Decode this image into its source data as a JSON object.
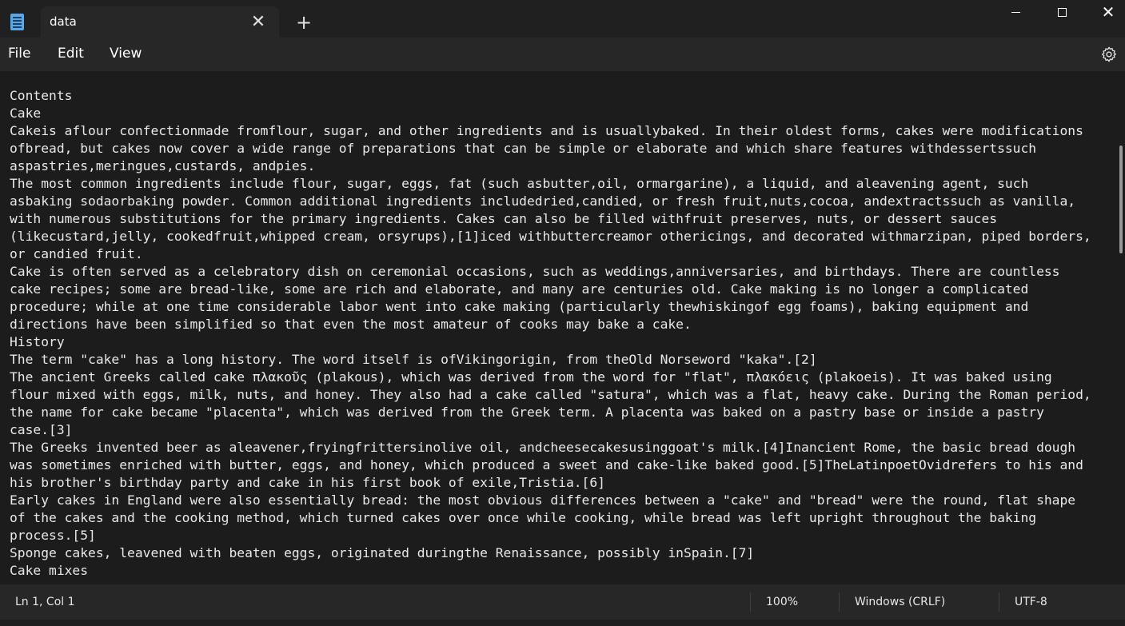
{
  "tab": {
    "title": "data",
    "close_icon": "close-icon"
  },
  "new_tab": "+",
  "window": {
    "minimize": "minimize-icon",
    "maximize": "maximize-icon",
    "close": "close-icon"
  },
  "menu": {
    "file": "File",
    "edit": "Edit",
    "view": "View"
  },
  "editor": {
    "lines": [
      "Contents",
      "Cake",
      "Cakeis aflour confectionmade fromflour, sugar, and other ingredients and is usuallybaked. In their oldest forms, cakes were modifications",
      "ofbread, but cakes now cover a wide range of preparations that can be simple or elaborate and which share features withdessertssuch",
      "aspastries,meringues,custards, andpies.",
      "The most common ingredients include flour, sugar, eggs, fat (such asbutter,oil, ormargarine), a liquid, and aleavening agent, such",
      "asbaking sodaorbaking powder. Common additional ingredients includedried,candied, or fresh fruit,nuts,cocoa, andextractssuch as vanilla,",
      "with numerous substitutions for the primary ingredients. Cakes can also be filled withfruit preserves, nuts, or dessert sauces",
      "(likecustard,jelly, cookedfruit,whipped cream, orsyrups),[1]iced withbuttercreamor othericings, and decorated withmarzipan, piped borders,",
      "or candied fruit.",
      "Cake is often served as a celebratory dish on ceremonial occasions, such as weddings,anniversaries, and birthdays. There are countless",
      "cake recipes; some are bread-like, some are rich and elaborate, and many are centuries old. Cake making is no longer a complicated",
      "procedure; while at one time considerable labor went into cake making (particularly thewhiskingof egg foams), baking equipment and",
      "directions have been simplified so that even the most amateur of cooks may bake a cake.",
      "History",
      "The term \"cake\" has a long history. The word itself is ofVikingorigin, from theOld Norseword \"kaka\".[2]",
      "The ancient Greeks called cake πλακοῦς (plakous), which was derived from the word for \"flat\", πλακόεις (plakoeis). It was baked using",
      "flour mixed with eggs, milk, nuts, and honey. They also had a cake called \"satura\", which was a flat, heavy cake. During the Roman period,",
      "the name for cake became \"placenta\", which was derived from the Greek term. A placenta was baked on a pastry base or inside a pastry",
      "case.[3]",
      "The Greeks invented beer as aleavener,fryingfrittersinolive oil, andcheesecakesusinggoat's milk.[4]Inancient Rome, the basic bread dough",
      "was sometimes enriched with butter, eggs, and honey, which produced a sweet and cake-like baked good.[5]TheLatinpoetOvidrefers to his and",
      "his brother's birthday party and cake in his first book of exile,Tristia.[6]",
      "Early cakes in England were also essentially bread: the most obvious differences between a \"cake\" and \"bread\" were the round, flat shape",
      "of the cakes and the cooking method, which turned cakes over once while cooking, while bread was left upright throughout the baking",
      "process.[5]",
      "Sponge cakes, leavened with beaten eggs, originated duringthe Renaissance, possibly inSpain.[7]",
      "Cake mixes"
    ]
  },
  "status": {
    "position": "Ln 1, Col 1",
    "zoom": "100%",
    "line_ending": "Windows (CRLF)",
    "encoding": "UTF-8"
  }
}
